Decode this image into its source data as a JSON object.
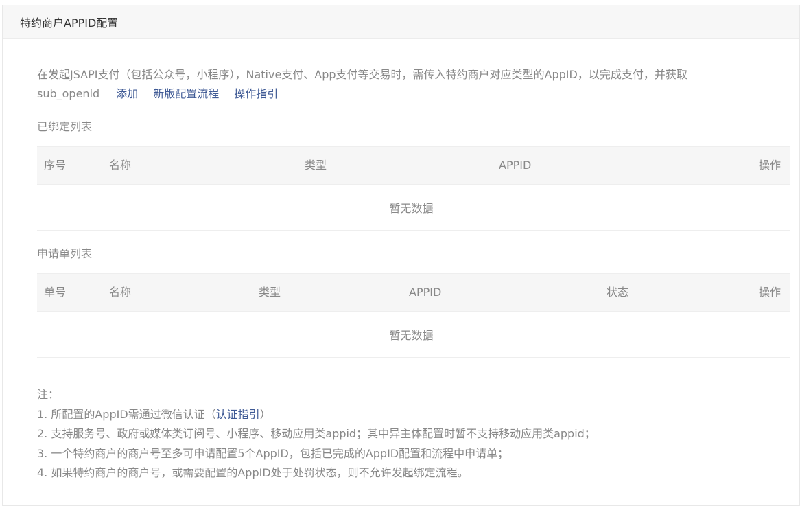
{
  "panel": {
    "title": "特约商户APPID配置"
  },
  "intro": {
    "text_line1": "在发起JSAPI支付（包括公众号，小程序），Native支付、App支付等交易时，需传入特约商户对应类型的AppID，以完成支付，并获取",
    "text_line2": "sub_openid",
    "links": {
      "add": "添加",
      "new_flow": "新版配置流程",
      "guide": "操作指引"
    }
  },
  "bound_list": {
    "title": "已绑定列表",
    "columns": [
      "序号",
      "名称",
      "类型",
      "APPID",
      "操作"
    ],
    "empty_text": "暂无数据"
  },
  "application_list": {
    "title": "申请单列表",
    "columns": [
      "单号",
      "名称",
      "类型",
      "APPID",
      "状态",
      "操作"
    ],
    "empty_text": "暂无数据"
  },
  "notes": {
    "heading": "注：",
    "item1_prefix": "1. 所配置的AppID需通过微信认证（",
    "item1_link": "认证指引",
    "item1_suffix": "）",
    "item2": "2. 支持服务号、政府或媒体类订阅号、小程序、移动应用类appid；其中异主体配置时暂不支持移动应用类appid；",
    "item3": "3. 一个特约商户的商户号至多可申请配置5个AppID，包括已完成的AppID配置和流程中申请单；",
    "item4": "4. 如果特约商户的商户号，或需要配置的AppID处于处罚状态，则不允许发起绑定流程。"
  }
}
